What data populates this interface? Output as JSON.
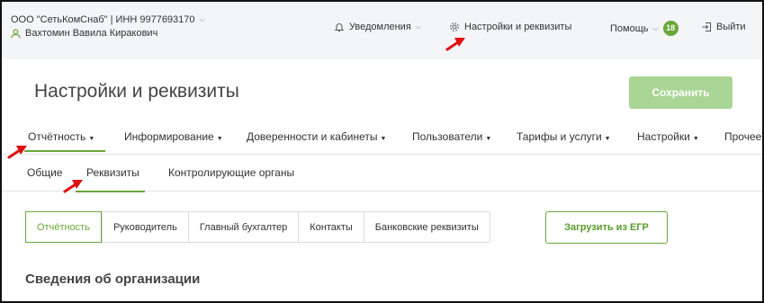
{
  "header": {
    "org_name": "ООО \"СетьКомСнаб\" | ИНН 9977693170",
    "user_name": "Вахтомин Вавила Киракович",
    "notifications": "Уведомления",
    "settings": "Настройки и реквизиты",
    "help": "Помощь",
    "help_badge": "18",
    "logout": "Выйти"
  },
  "page": {
    "title": "Настройки и реквизиты",
    "save_label": "Сохранить"
  },
  "main_nav": [
    {
      "label": "Отчётность"
    },
    {
      "label": "Информирование"
    },
    {
      "label": "Доверенности и кабинеты"
    },
    {
      "label": "Пользователи"
    },
    {
      "label": "Тарифы и услуги"
    },
    {
      "label": "Настройки"
    },
    {
      "label": "Прочее"
    }
  ],
  "sub_nav": [
    {
      "label": "Общие"
    },
    {
      "label": "Реквизиты"
    },
    {
      "label": "Контролирующие органы"
    }
  ],
  "segments": [
    {
      "label": "Отчётность"
    },
    {
      "label": "Руководитель"
    },
    {
      "label": "Главный бухгалтер"
    },
    {
      "label": "Контакты"
    },
    {
      "label": "Банковские реквизиты"
    }
  ],
  "egr_button": "Загрузить из ЕГР",
  "section_title": "Сведения об организации",
  "colors": {
    "accent": "#6aa73a",
    "save_disabled": "#a9d595",
    "header_bg": "#f4f5f7",
    "annotation_arrow": "#e01010"
  },
  "icons": {
    "bell": "bell-icon",
    "gear": "gear-icon",
    "logout": "logout-icon",
    "user": "user-icon"
  }
}
